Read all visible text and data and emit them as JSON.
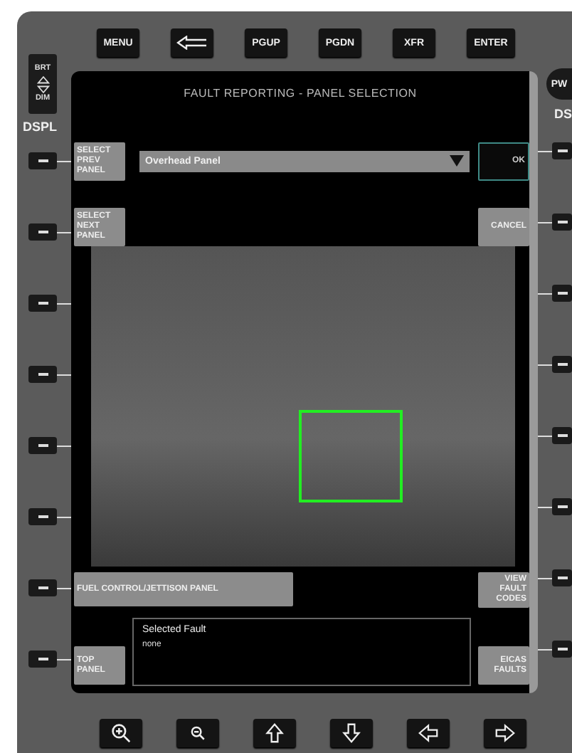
{
  "top_keys": [
    {
      "kind": "text",
      "label": "MENU"
    },
    {
      "kind": "back-arrow"
    },
    {
      "kind": "text",
      "label": "PGUP"
    },
    {
      "kind": "text",
      "label": "PGDN"
    },
    {
      "kind": "text",
      "label": "XFR"
    },
    {
      "kind": "text",
      "label": "ENTER"
    }
  ],
  "brightness": {
    "up_label": "BRT",
    "down_label": "DIM",
    "display_label": "DSPL"
  },
  "power": {
    "label": "PW",
    "display_label": "DS"
  },
  "screen": {
    "title": "FAULT REPORTING - PANEL SELECTION",
    "select_prev_panel": "SELECT PREV PANEL",
    "panel_dropdown": {
      "value": "Overhead Panel"
    },
    "ok_button": "OK",
    "select_next_panel": "SELECT NEXT PANEL",
    "cancel_button": "CANCEL",
    "fuel_control_button": "FUEL CONTROL/JETTISON PANEL",
    "view_fault_codes_button": "VIEW FAULT CODES",
    "top_panel_button": "TOP PANEL",
    "selected_fault": {
      "heading": "Selected Fault",
      "value": "none"
    },
    "eicas_faults_button": "EICAS FAULTS"
  },
  "bottom_keys": [
    {
      "kind": "zoom-in"
    },
    {
      "kind": "zoom-out"
    },
    {
      "kind": "arrow-up"
    },
    {
      "kind": "arrow-down"
    },
    {
      "kind": "arrow-left"
    },
    {
      "kind": "arrow-right"
    }
  ]
}
